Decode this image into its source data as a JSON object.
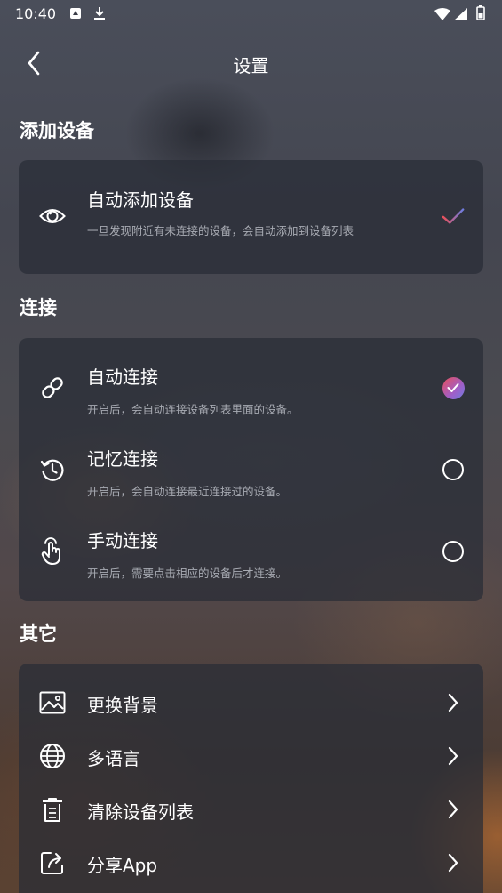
{
  "status_bar": {
    "time": "10:40",
    "icons": [
      "notification-icon",
      "download-icon",
      "wifi-icon",
      "signal-icon",
      "battery-icon"
    ]
  },
  "header": {
    "title": "设置",
    "back_icon": "back-arrow-icon"
  },
  "sections": {
    "add_device": {
      "title": "添加设备",
      "items": [
        {
          "label": "自动添加设备",
          "desc": "一旦发现附近有未连接的设备，会自动添加到设备列表",
          "icon": "eye-icon",
          "checked": true
        }
      ]
    },
    "connect": {
      "title": "连接",
      "items": [
        {
          "label": "自动连接",
          "desc": "开启后，会自动连接设备列表里面的设备。",
          "icon": "link-icon",
          "selected": true
        },
        {
          "label": "记忆连接",
          "desc": "开启后，会自动连接最近连接过的设备。",
          "icon": "history-icon",
          "selected": false
        },
        {
          "label": "手动连接",
          "desc": "开启后，需要点击相应的设备后才连接。",
          "icon": "tap-hand-icon",
          "selected": false
        }
      ]
    },
    "other": {
      "title": "其它",
      "items": [
        {
          "label": "更换背景",
          "icon": "image-icon"
        },
        {
          "label": "多语言",
          "icon": "globe-icon"
        },
        {
          "label": "清除设备列表",
          "icon": "trash-icon"
        },
        {
          "label": "分享App",
          "icon": "share-icon"
        }
      ]
    }
  },
  "colors": {
    "accent_gradient_start": "#e8505a",
    "accent_gradient_end": "#6f7de0",
    "card_bg": "#282c36",
    "desc_text": "#a8abb3"
  }
}
